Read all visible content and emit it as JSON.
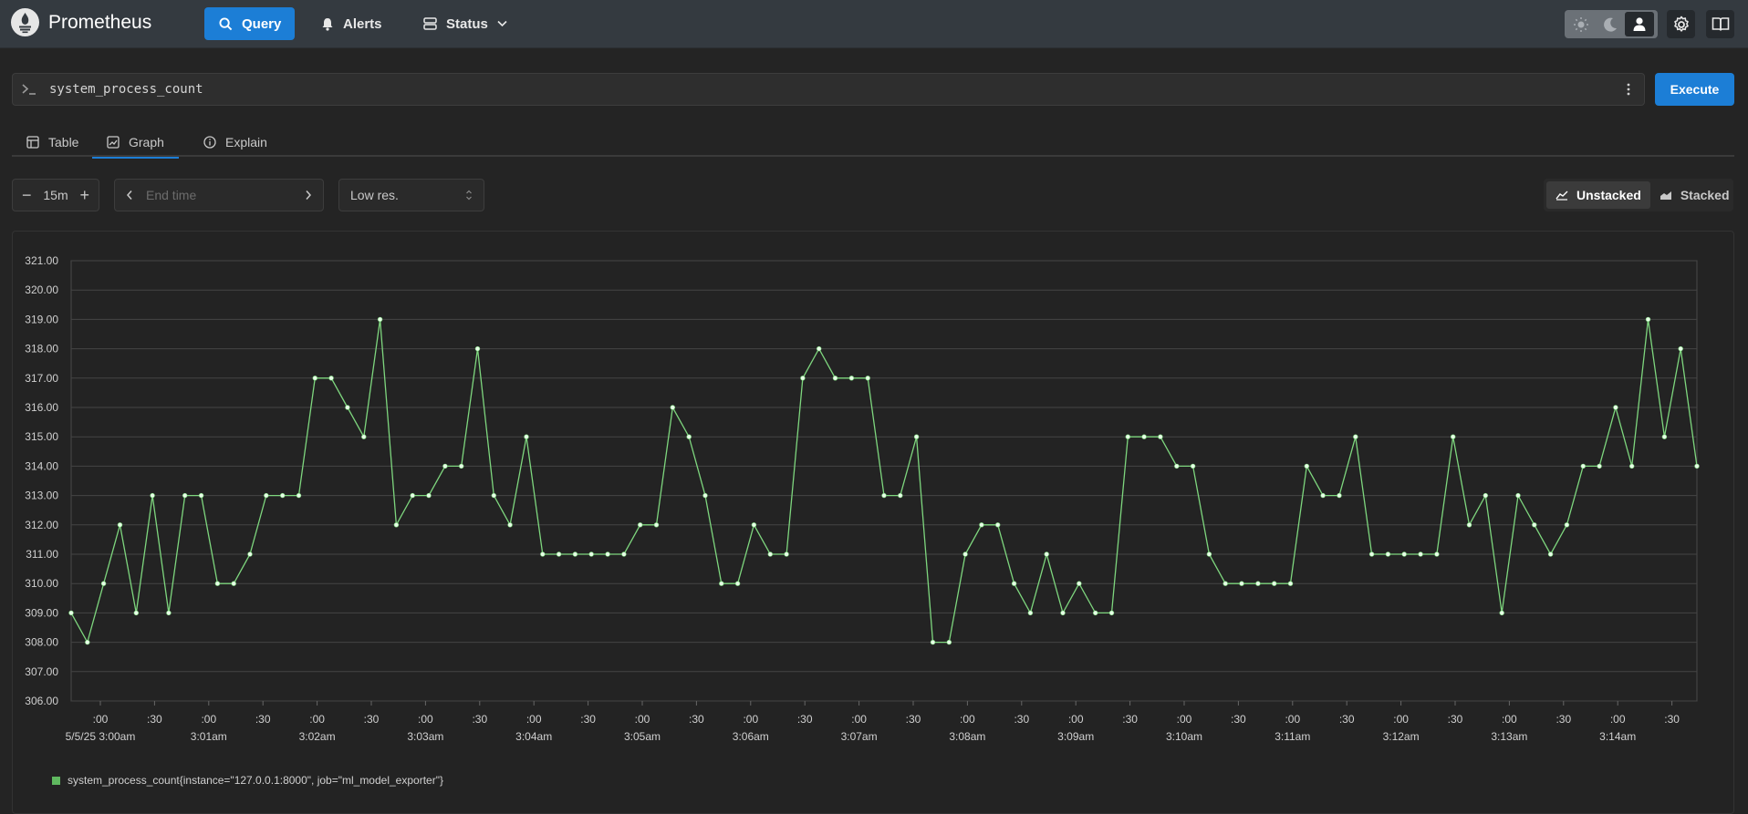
{
  "app": {
    "name": "Prometheus"
  },
  "nav": {
    "query": "Query",
    "alerts": "Alerts",
    "status": "Status"
  },
  "query": {
    "expression": "system_process_count",
    "execute": "Execute"
  },
  "tabs": [
    "Table",
    "Graph",
    "Explain"
  ],
  "active_tab": "Graph",
  "controls": {
    "range": "15m",
    "end_time_placeholder": "End time",
    "resolution": "Low res.",
    "unstacked": "Unstacked",
    "stacked": "Stacked"
  },
  "colors": {
    "accent": "#1c7ed6",
    "series": "#7ed67e"
  },
  "chart_data": {
    "type": "line",
    "ylim": [
      306,
      321
    ],
    "y_ticks": [
      "321.00",
      "320.00",
      "319.00",
      "318.00",
      "317.00",
      "316.00",
      "315.00",
      "314.00",
      "313.00",
      "312.00",
      "311.00",
      "310.00",
      "309.00",
      "308.00",
      "307.00",
      "306.00"
    ],
    "x_ticks": [
      [
        ":00",
        "5/5/25 3:00am"
      ],
      [
        ":30",
        ""
      ],
      [
        ":00",
        "3:01am"
      ],
      [
        ":30",
        ""
      ],
      [
        ":00",
        "3:02am"
      ],
      [
        ":30",
        ""
      ],
      [
        ":00",
        "3:03am"
      ],
      [
        ":30",
        ""
      ],
      [
        ":00",
        "3:04am"
      ],
      [
        ":30",
        ""
      ],
      [
        ":00",
        "3:05am"
      ],
      [
        ":30",
        ""
      ],
      [
        ":00",
        "3:06am"
      ],
      [
        ":30",
        ""
      ],
      [
        ":00",
        "3:07am"
      ],
      [
        ":30",
        ""
      ],
      [
        ":00",
        "3:08am"
      ],
      [
        ":30",
        ""
      ],
      [
        ":00",
        "3:09am"
      ],
      [
        ":30",
        ""
      ],
      [
        ":00",
        "3:10am"
      ],
      [
        ":30",
        ""
      ],
      [
        ":00",
        "3:11am"
      ],
      [
        ":30",
        ""
      ],
      [
        ":00",
        "3:12am"
      ],
      [
        ":30",
        ""
      ],
      [
        ":00",
        "3:13am"
      ],
      [
        ":30",
        ""
      ],
      [
        ":00",
        "3:14am"
      ],
      [
        ":30",
        ""
      ]
    ],
    "grid": true,
    "series": [
      {
        "name": "system_process_count{instance=\"127.0.0.1:8000\", job=\"ml_model_exporter\"}",
        "values": [
          309,
          308,
          310,
          312,
          309,
          313,
          309,
          313,
          313,
          310,
          310,
          311,
          313,
          313,
          313,
          317,
          317,
          316,
          315,
          319,
          312,
          313,
          313,
          314,
          314,
          318,
          313,
          312,
          315,
          311,
          311,
          311,
          311,
          311,
          311,
          312,
          312,
          316,
          315,
          313,
          310,
          310,
          312,
          311,
          311,
          317,
          318,
          317,
          317,
          317,
          313,
          313,
          315,
          308,
          308,
          311,
          312,
          312,
          310,
          309,
          311,
          309,
          310,
          309,
          309,
          315,
          315,
          315,
          314,
          314,
          311,
          310,
          310,
          310,
          310,
          310,
          314,
          313,
          313,
          315,
          311,
          311,
          311,
          311,
          311,
          315,
          312,
          313,
          309,
          313,
          312,
          311,
          312,
          314,
          314,
          316,
          314,
          319,
          315,
          318,
          314
        ]
      }
    ]
  }
}
